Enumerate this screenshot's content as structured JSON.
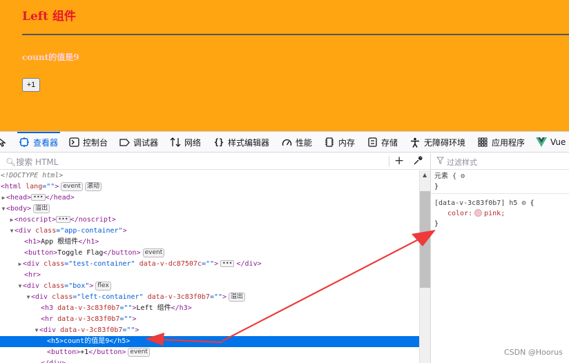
{
  "page": {
    "title": "Left 组件",
    "count_text": "count的值是9",
    "button_label": "+1",
    "colors": {
      "background": "#ffa511",
      "title": "#e8162d",
      "count": "#ffd0dc"
    }
  },
  "devtools": {
    "tabs": [
      {
        "label": "查看器",
        "icon": "inspector-icon",
        "active": true
      },
      {
        "label": "控制台",
        "icon": "console-icon"
      },
      {
        "label": "调试器",
        "icon": "debugger-icon"
      },
      {
        "label": "网络",
        "icon": "network-icon"
      },
      {
        "label": "样式编辑器",
        "icon": "style-editor-icon"
      },
      {
        "label": "性能",
        "icon": "performance-icon"
      },
      {
        "label": "内存",
        "icon": "memory-icon"
      },
      {
        "label": "存储",
        "icon": "storage-icon"
      },
      {
        "label": "无障碍环境",
        "icon": "accessibility-icon"
      },
      {
        "label": "应用程序",
        "icon": "application-icon"
      },
      {
        "label": "Vue",
        "icon": "vue-icon"
      }
    ],
    "search_placeholder": "搜索 HTML",
    "filter_placeholder": "过滤样式",
    "badges": {
      "event": "event",
      "scroll": "滚动",
      "overflow": "溢出",
      "flex": "flex"
    },
    "markup": {
      "doctype": "<!DOCTYPE html>",
      "html_open": "<html",
      "html_lang_attr": "lang",
      "html_lang_val": "=\"\"",
      "head_open": "<head>",
      "head_close": "</head>",
      "body_open": "<body>",
      "noscript_open": "<noscript>",
      "noscript_close": "</noscript>",
      "div_open": "<div",
      "gt": ">",
      "div_close": "</div>",
      "class_attr": "class",
      "app_container_val": "=\"app-container\"",
      "h1_open": "<h1>",
      "h1_text": "App 根组件",
      "h1_close": "</h1>",
      "button_open": "<button>",
      "button_toggle_text": "Toggle Flag",
      "button_close": "</button>",
      "test_container_val": "=\"test-container\"",
      "data_v_dc_attr": "data-v-dc87507c",
      "empty_val": "=\"\"",
      "hr": "<hr>",
      "box_val": "=\"box\"",
      "left_container_val": "=\"left-container\"",
      "data_v_3c_attr": "data-v-3c83f0b7",
      "h3_open": "<h3",
      "h3_text": "Left 组件",
      "h3_close": "</h3>",
      "hr_open": "<hr",
      "h5_open": "<h5>",
      "h5_text": "count的值是9",
      "h5_close": "</h5>",
      "button_plus_text": "+1"
    },
    "rules": {
      "element_selector": "元素 {",
      "close_brace": "}",
      "scoped_selector": "[data-v-3c83f0b7] h5",
      "open_brace": "{",
      "color_prop": "color:",
      "color_value": "pink;"
    }
  },
  "watermark": "CSDN @Hoorus"
}
